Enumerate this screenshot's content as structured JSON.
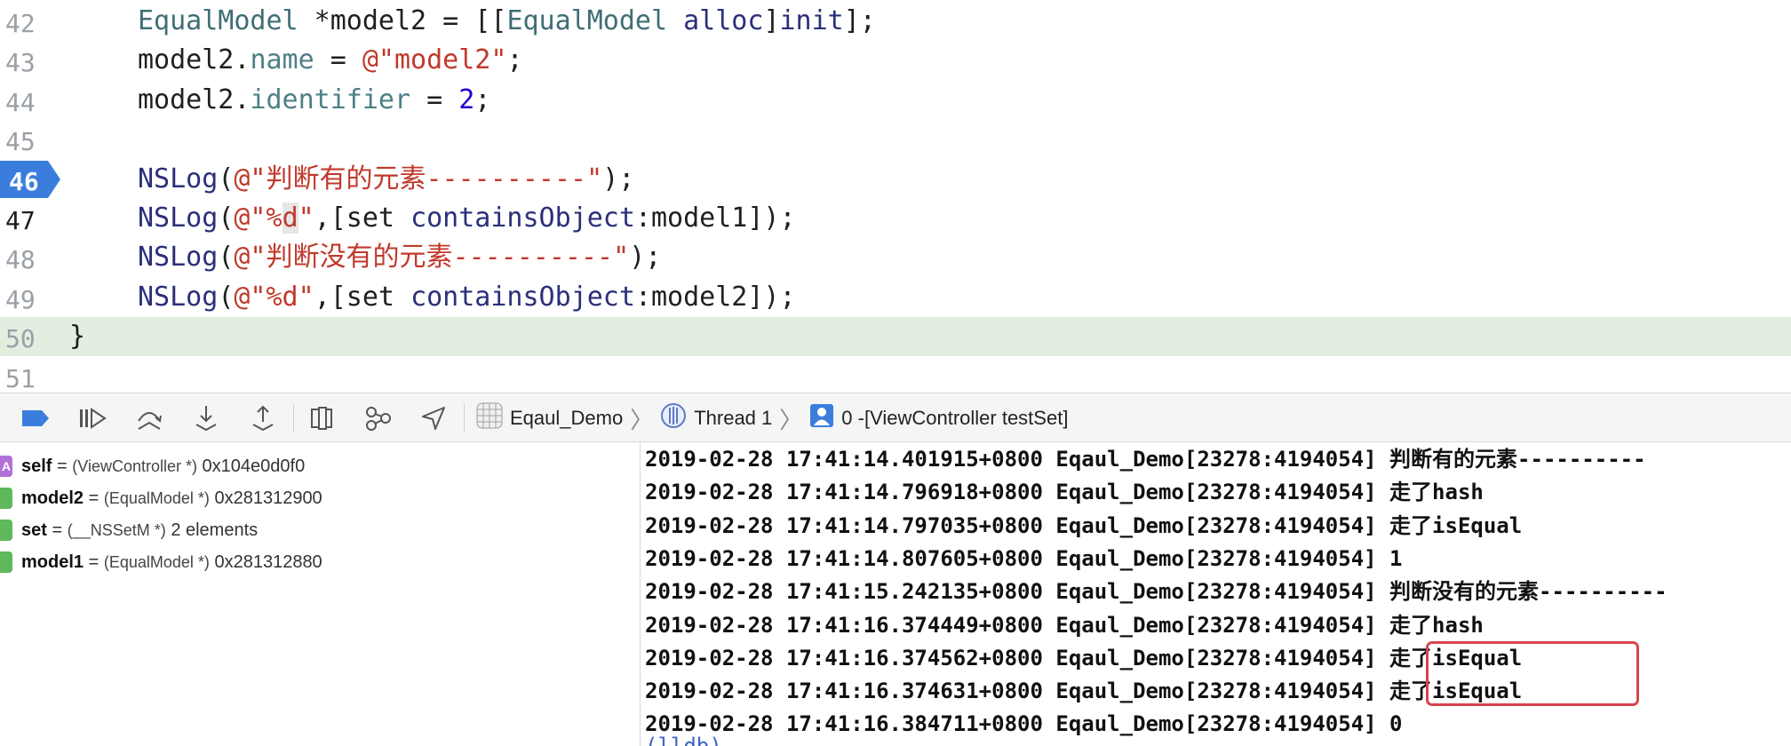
{
  "editor": {
    "lines": [
      {
        "num": "42",
        "tokens": [
          {
            "t": "EqualModel",
            "c": "type"
          },
          {
            "t": " *model2 = [[",
            "c": "plain"
          },
          {
            "t": "EqualModel",
            "c": "type"
          },
          {
            "t": " ",
            "c": "plain"
          },
          {
            "t": "alloc",
            "c": "fn"
          },
          {
            "t": "]",
            "c": "plain"
          },
          {
            "t": "init",
            "c": "fn"
          },
          {
            "t": "];",
            "c": "plain"
          }
        ]
      },
      {
        "num": "43",
        "tokens": [
          {
            "t": "model2.",
            "c": "plain"
          },
          {
            "t": "name",
            "c": "prop"
          },
          {
            "t": " = ",
            "c": "plain"
          },
          {
            "t": "@\"model2\"",
            "c": "str"
          },
          {
            "t": ";",
            "c": "plain"
          }
        ]
      },
      {
        "num": "44",
        "tokens": [
          {
            "t": "model2.",
            "c": "plain"
          },
          {
            "t": "identifier",
            "c": "prop"
          },
          {
            "t": " = ",
            "c": "plain"
          },
          {
            "t": "2",
            "c": "num"
          },
          {
            "t": ";",
            "c": "plain"
          }
        ]
      },
      {
        "num": "45",
        "tokens": []
      },
      {
        "num": "46",
        "tokens": [
          {
            "t": "NSLog",
            "c": "fn"
          },
          {
            "t": "(",
            "c": "plain"
          },
          {
            "t": "@\"判断有的元素----------\"",
            "c": "str"
          },
          {
            "t": ");",
            "c": "plain"
          }
        ]
      },
      {
        "num": "47",
        "tokens": [
          {
            "t": "NSLog",
            "c": "fn"
          },
          {
            "t": "(",
            "c": "plain"
          },
          {
            "t": "@\"%",
            "c": "str"
          },
          {
            "t": "d",
            "c": "strhl"
          },
          {
            "t": "\"",
            "c": "str"
          },
          {
            "t": ",[set ",
            "c": "plain"
          },
          {
            "t": "containsObject",
            "c": "fn"
          },
          {
            "t": ":model1]);",
            "c": "plain"
          }
        ]
      },
      {
        "num": "48",
        "tokens": [
          {
            "t": "NSLog",
            "c": "fn"
          },
          {
            "t": "(",
            "c": "plain"
          },
          {
            "t": "@\"判断没有的元素----------\"",
            "c": "str"
          },
          {
            "t": ");",
            "c": "plain"
          }
        ]
      },
      {
        "num": "49",
        "tokens": [
          {
            "t": "NSLog",
            "c": "fn"
          },
          {
            "t": "(",
            "c": "plain"
          },
          {
            "t": "@\"%d\"",
            "c": "str"
          },
          {
            "t": ",[set ",
            "c": "plain"
          },
          {
            "t": "containsObject",
            "c": "fn"
          },
          {
            "t": ":model2]);",
            "c": "plain"
          }
        ]
      },
      {
        "num": "50",
        "tokens": [
          {
            "t": "}",
            "c": "plain"
          }
        ]
      },
      {
        "num": "51",
        "tokens": []
      }
    ],
    "breakpoint_line": "46",
    "current_line": "50"
  },
  "debugbar": {
    "icons": [
      "breakpoints-toggle-icon",
      "continue-icon",
      "step-over-icon",
      "step-into-icon",
      "step-out-icon",
      "view-hierarchy-icon",
      "memory-graph-icon",
      "location-icon"
    ],
    "app_name": "Eqaul_Demo",
    "thread": "Thread 1",
    "frame": "0 -[ViewController testSet]"
  },
  "variables": [
    {
      "badge": "A",
      "badge_color": "#b070d8",
      "name": "self",
      "type": "(ViewController *)",
      "value": "0x104e0d0f0"
    },
    {
      "badge": "L",
      "badge_color": "#5fb85a",
      "name": "model2",
      "type": "(EqualModel *)",
      "value": "0x281312900"
    },
    {
      "badge": "L",
      "badge_color": "#5fb85a",
      "name": "set",
      "type": "(__NSSetM *)",
      "value": "2 elements"
    },
    {
      "badge": "L",
      "badge_color": "#5fb85a",
      "name": "model1",
      "type": "(EqualModel *)",
      "value": "0x281312880"
    }
  ],
  "console": {
    "lines": [
      "2019-02-28 17:41:14.401915+0800 Eqaul_Demo[23278:4194054] 判断有的元素----------",
      "2019-02-28 17:41:14.796918+0800 Eqaul_Demo[23278:4194054] 走了hash",
      "2019-02-28 17:41:14.797035+0800 Eqaul_Demo[23278:4194054] 走了isEqual",
      "2019-02-28 17:41:14.807605+0800 Eqaul_Demo[23278:4194054] 1",
      "2019-02-28 17:41:15.242135+0800 Eqaul_Demo[23278:4194054] 判断没有的元素----------",
      "2019-02-28 17:41:16.374449+0800 Eqaul_Demo[23278:4194054] 走了hash",
      "2019-02-28 17:41:16.374562+0800 Eqaul_Demo[23278:4194054] 走了isEqual",
      "2019-02-28 17:41:16.374631+0800 Eqaul_Demo[23278:4194054] 走了isEqual",
      "2019-02-28 17:41:16.384711+0800 Eqaul_Demo[23278:4194054] 0"
    ],
    "prompt": "(lldb)"
  },
  "colors": {
    "breakpoint": "#3b7ddd",
    "current_line_bg": "#e3ede0",
    "highlight_box": "#d9434f"
  }
}
